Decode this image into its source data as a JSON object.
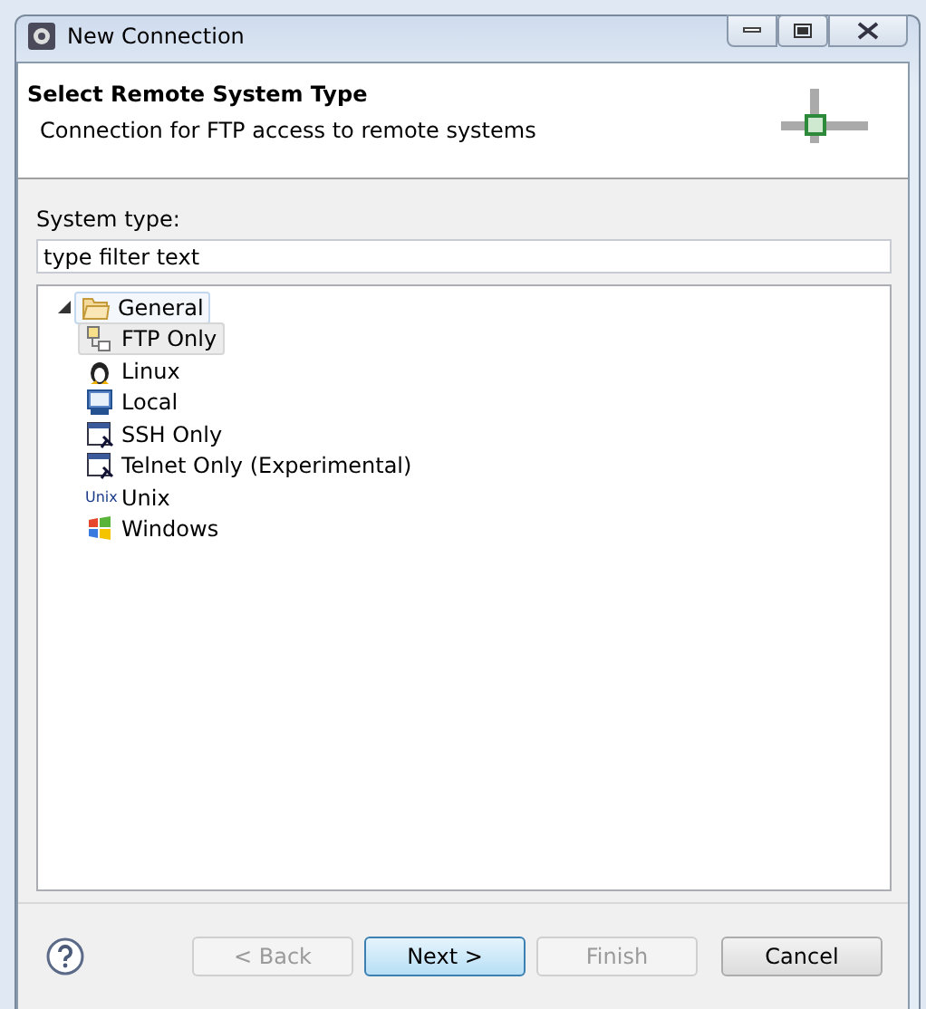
{
  "window": {
    "title": "New Connection"
  },
  "header": {
    "title": "Select Remote System Type",
    "description": "Connection for FTP access to remote systems"
  },
  "filter": {
    "label": "System type:",
    "value": "type filter text"
  },
  "tree": [
    {
      "label": "General",
      "kind": "folder",
      "expanded": true,
      "selected": false,
      "focused": true,
      "children": [
        {
          "label": "FTP Only",
          "kind": "ftp",
          "selected": true,
          "focused": false
        },
        {
          "label": "Linux",
          "kind": "linux",
          "selected": false,
          "focused": false
        },
        {
          "label": "Local",
          "kind": "local",
          "selected": false,
          "focused": false
        },
        {
          "label": "SSH Only",
          "kind": "terminal",
          "selected": false,
          "focused": false
        },
        {
          "label": "Telnet Only (Experimental)",
          "kind": "terminal",
          "selected": false,
          "focused": false
        },
        {
          "label": "Unix",
          "kind": "unix",
          "icon_text": "Unix",
          "selected": false,
          "focused": false
        },
        {
          "label": "Windows",
          "kind": "windows",
          "selected": false,
          "focused": false
        }
      ]
    }
  ],
  "buttons": [
    {
      "label": "< Back",
      "disabled": true,
      "default": false
    },
    {
      "label": "Next >",
      "disabled": false,
      "default": true
    },
    {
      "label": "Finish",
      "disabled": true,
      "default": false
    },
    {
      "label": "Cancel",
      "disabled": false,
      "default": false
    }
  ]
}
